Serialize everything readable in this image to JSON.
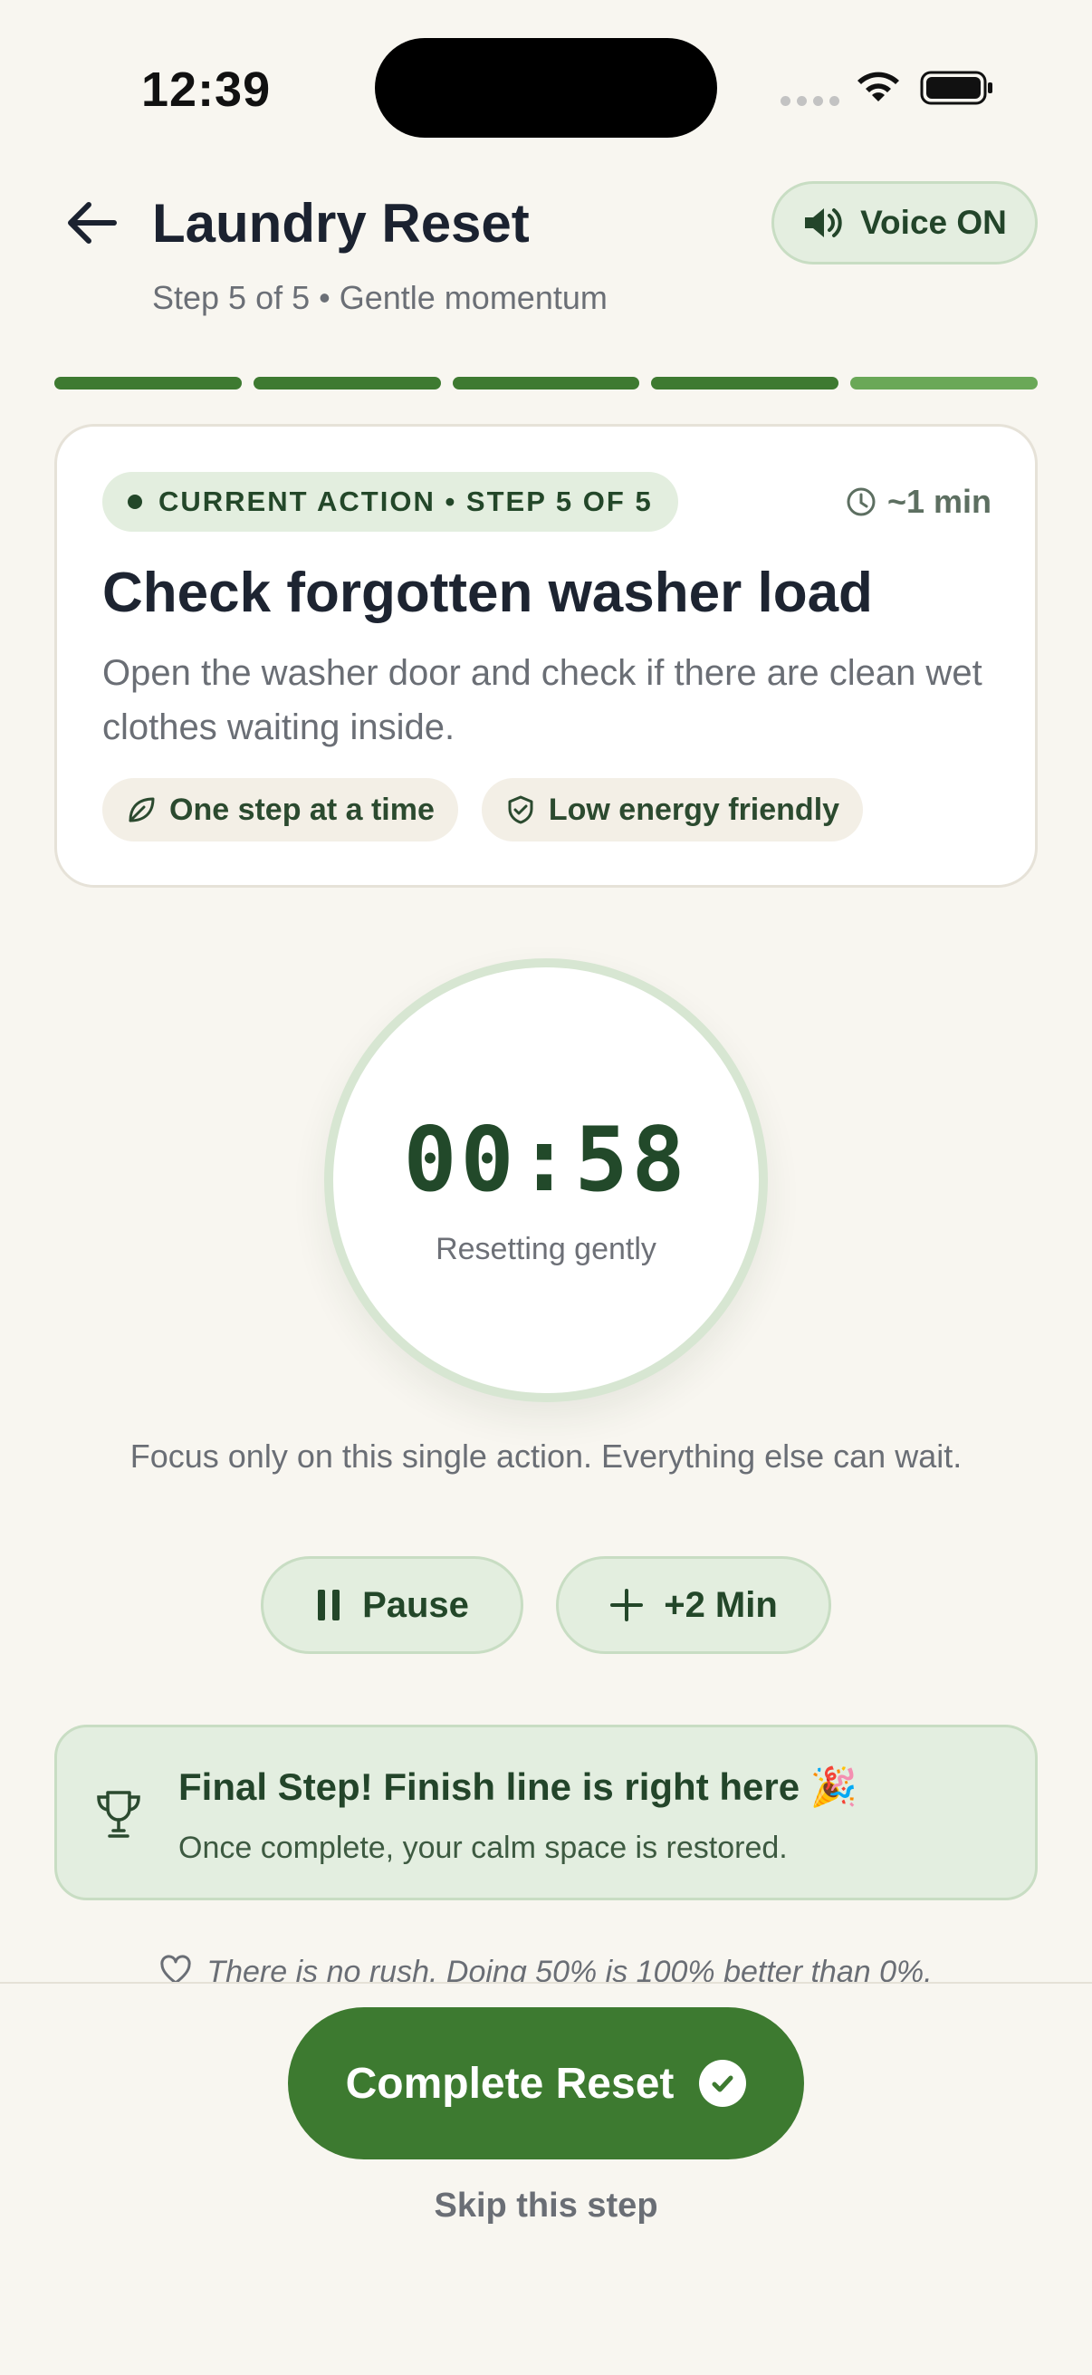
{
  "status_bar": {
    "time": "12:39"
  },
  "header": {
    "title": "Laundry Reset",
    "subtitle": "Step 5 of 5 • Gentle momentum",
    "voice_label": "Voice ON"
  },
  "progress": {
    "total_steps": 5,
    "current_step": 5
  },
  "action_card": {
    "badge": "CURRENT ACTION • STEP 5 OF 5",
    "duration": "~1 min",
    "title": "Check forgotten washer load",
    "description": "Open the washer door and check if there are clean wet clothes waiting inside.",
    "chips": [
      {
        "label": "One step at a time",
        "icon": "leaf-icon"
      },
      {
        "label": "Low energy friendly",
        "icon": "shield-check-icon"
      }
    ]
  },
  "timer": {
    "value": "00:58",
    "label": "Resetting gently"
  },
  "focus_text": "Focus only on this single action. Everything else can wait.",
  "controls": {
    "pause_label": "Pause",
    "add_time_label": "+2 Min"
  },
  "final_banner": {
    "title": "Final Step! Finish line is right here 🎉",
    "subtitle": "Once complete, your calm space is restored."
  },
  "note": "There is no rush. Doing 50% is 100% better than 0%.",
  "footer": {
    "complete_label": "Complete Reset",
    "skip_label": "Skip this step"
  },
  "colors": {
    "accent": "#3d7a30",
    "accent_light": "#e3eedf",
    "background": "#f8f6f0"
  }
}
